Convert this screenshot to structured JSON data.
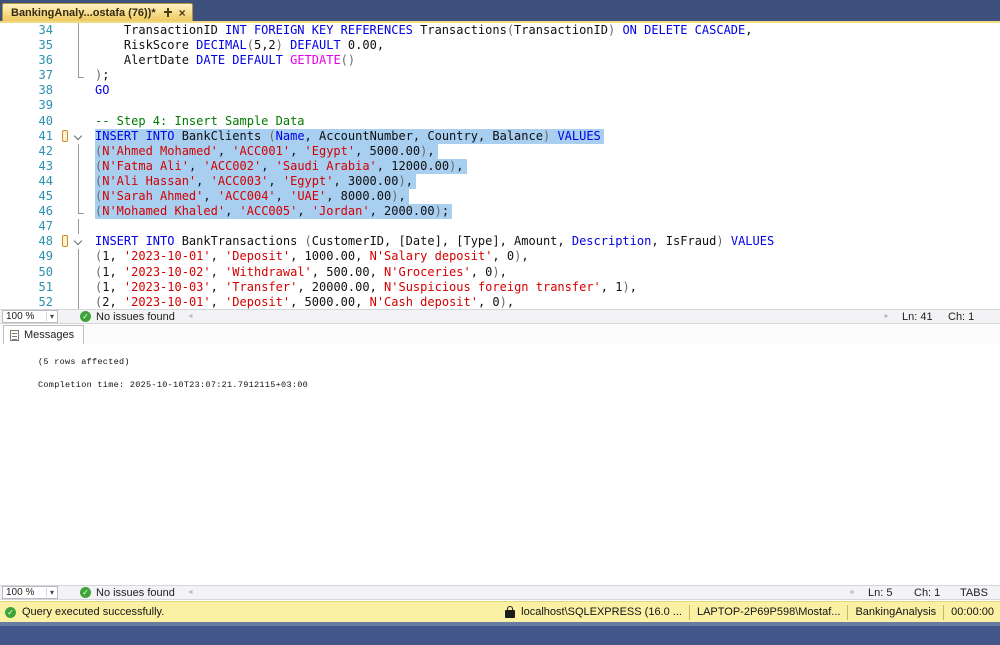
{
  "window": {
    "tab_title": "BankingAnaly...ostafa (76))*"
  },
  "icons": {
    "close": "×",
    "dropdown": "▾",
    "scroll_left": "◄",
    "scroll_right": "►",
    "check": "✓"
  },
  "colors": {
    "tab_active": "#EFC95F",
    "selection": "#A8CEF0",
    "keyword": "#0000E6",
    "string": "#D40000",
    "comment": "#007A00",
    "system_function": "#E800E8",
    "line_number": "#2B91AF",
    "success_bar": "#FAF1A5",
    "check_green": "#3EA437",
    "band_blue": "#3E517E"
  },
  "editor": {
    "lines": [
      {
        "n": 34,
        "fold": "line",
        "segs": [
          {
            "t": "    TransactionID ",
            "c": "id"
          },
          {
            "t": "INT FOREIGN KEY REFERENCES",
            "c": "kw"
          },
          {
            "t": " Transactions",
            "c": "id"
          },
          {
            "t": "(",
            "c": "op"
          },
          {
            "t": "TransactionID",
            "c": "id"
          },
          {
            "t": ")",
            "c": "op"
          },
          {
            "t": " ",
            "c": "id"
          },
          {
            "t": "ON DELETE CASCADE",
            "c": "kw"
          },
          {
            "t": ",",
            "c": "id"
          }
        ]
      },
      {
        "n": 35,
        "fold": "line",
        "segs": [
          {
            "t": "    RiskScore ",
            "c": "id"
          },
          {
            "t": "DECIMAL",
            "c": "kw"
          },
          {
            "t": "(",
            "c": "op"
          },
          {
            "t": "5,2",
            "c": "id"
          },
          {
            "t": ")",
            "c": "op"
          },
          {
            "t": " ",
            "c": "id"
          },
          {
            "t": "DEFAULT",
            "c": "kw"
          },
          {
            "t": " 0.00,",
            "c": "id"
          }
        ]
      },
      {
        "n": 36,
        "fold": "line",
        "segs": [
          {
            "t": "    AlertDate ",
            "c": "id"
          },
          {
            "t": "DATE DEFAULT",
            "c": "kw"
          },
          {
            "t": " ",
            "c": "id"
          },
          {
            "t": "GETDATE",
            "c": "fn"
          },
          {
            "t": "()",
            "c": "op"
          }
        ]
      },
      {
        "n": 37,
        "fold": "end",
        "segs": [
          {
            "t": ")",
            "c": "op"
          },
          {
            "t": ";",
            "c": "id"
          }
        ]
      },
      {
        "n": 38,
        "fold": "",
        "segs": [
          {
            "t": "GO",
            "c": "kw"
          }
        ]
      },
      {
        "n": 39,
        "fold": "",
        "segs": []
      },
      {
        "n": 40,
        "fold": "",
        "segs": [
          {
            "t": "-- Step 4: Insert Sample Data",
            "c": "com"
          }
        ]
      },
      {
        "n": 41,
        "fold": "open",
        "changed": true,
        "sel": true,
        "segs": [
          {
            "t": "INSERT INTO",
            "c": "kw"
          },
          {
            "t": " BankClients ",
            "c": "id"
          },
          {
            "t": "(",
            "c": "op"
          },
          {
            "t": "Name",
            "c": "kw"
          },
          {
            "t": ", AccountNumber, Country, Balance",
            "c": "id"
          },
          {
            "t": ")",
            "c": "op"
          },
          {
            "t": " ",
            "c": "id"
          },
          {
            "t": "VALUES",
            "c": "kw"
          }
        ]
      },
      {
        "n": 42,
        "fold": "line",
        "sel": true,
        "segs": [
          {
            "t": "(",
            "c": "op"
          },
          {
            "t": "N'Ahmed Mohamed'",
            "c": "str"
          },
          {
            "t": ", ",
            "c": "id"
          },
          {
            "t": "'ACC001'",
            "c": "str"
          },
          {
            "t": ", ",
            "c": "id"
          },
          {
            "t": "'Egypt'",
            "c": "str"
          },
          {
            "t": ", 5000.00",
            "c": "id"
          },
          {
            "t": ")",
            "c": "op"
          },
          {
            "t": ",",
            "c": "id"
          }
        ]
      },
      {
        "n": 43,
        "fold": "line",
        "sel": true,
        "segs": [
          {
            "t": "(",
            "c": "op"
          },
          {
            "t": "N'Fatma Ali'",
            "c": "str"
          },
          {
            "t": ", ",
            "c": "id"
          },
          {
            "t": "'ACC002'",
            "c": "str"
          },
          {
            "t": ", ",
            "c": "id"
          },
          {
            "t": "'Saudi Arabia'",
            "c": "str"
          },
          {
            "t": ", 12000.00",
            "c": "id"
          },
          {
            "t": ")",
            "c": "op"
          },
          {
            "t": ",",
            "c": "id"
          }
        ]
      },
      {
        "n": 44,
        "fold": "line",
        "sel": true,
        "segs": [
          {
            "t": "(",
            "c": "op"
          },
          {
            "t": "N'Ali Hassan'",
            "c": "str"
          },
          {
            "t": ", ",
            "c": "id"
          },
          {
            "t": "'ACC003'",
            "c": "str"
          },
          {
            "t": ", ",
            "c": "id"
          },
          {
            "t": "'Egypt'",
            "c": "str"
          },
          {
            "t": ", 3000.00",
            "c": "id"
          },
          {
            "t": ")",
            "c": "op"
          },
          {
            "t": ",",
            "c": "id"
          }
        ]
      },
      {
        "n": 45,
        "fold": "line",
        "sel": true,
        "segs": [
          {
            "t": "(",
            "c": "op"
          },
          {
            "t": "N'Sarah Ahmed'",
            "c": "str"
          },
          {
            "t": ", ",
            "c": "id"
          },
          {
            "t": "'ACC004'",
            "c": "str"
          },
          {
            "t": ", ",
            "c": "id"
          },
          {
            "t": "'UAE'",
            "c": "str"
          },
          {
            "t": ", 8000.00",
            "c": "id"
          },
          {
            "t": ")",
            "c": "op"
          },
          {
            "t": ",",
            "c": "id"
          }
        ]
      },
      {
        "n": 46,
        "fold": "end",
        "sel": true,
        "segs": [
          {
            "t": "(",
            "c": "op"
          },
          {
            "t": "N'Mohamed Khaled'",
            "c": "str"
          },
          {
            "t": ", ",
            "c": "id"
          },
          {
            "t": "'ACC005'",
            "c": "str"
          },
          {
            "t": ", ",
            "c": "id"
          },
          {
            "t": "'Jordan'",
            "c": "str"
          },
          {
            "t": ", 2000.00",
            "c": "id"
          },
          {
            "t": ")",
            "c": "op"
          },
          {
            "t": ";",
            "c": "id"
          }
        ]
      },
      {
        "n": 47,
        "fold": "line",
        "segs": []
      },
      {
        "n": 48,
        "fold": "open",
        "changed": true,
        "segs": [
          {
            "t": "INSERT INTO",
            "c": "kw"
          },
          {
            "t": " BankTransactions ",
            "c": "id"
          },
          {
            "t": "(",
            "c": "op"
          },
          {
            "t": "CustomerID, [Date], [Type], Amount, ",
            "c": "id"
          },
          {
            "t": "Description",
            "c": "kw"
          },
          {
            "t": ", IsFraud",
            "c": "id"
          },
          {
            "t": ")",
            "c": "op"
          },
          {
            "t": " ",
            "c": "id"
          },
          {
            "t": "VALUES",
            "c": "kw"
          }
        ]
      },
      {
        "n": 49,
        "fold": "line",
        "segs": [
          {
            "t": "(",
            "c": "op"
          },
          {
            "t": "1, ",
            "c": "id"
          },
          {
            "t": "'2023-10-01'",
            "c": "str"
          },
          {
            "t": ", ",
            "c": "id"
          },
          {
            "t": "'Deposit'",
            "c": "str"
          },
          {
            "t": ", 1000.00, ",
            "c": "id"
          },
          {
            "t": "N'Salary deposit'",
            "c": "str"
          },
          {
            "t": ", 0",
            "c": "id"
          },
          {
            "t": ")",
            "c": "op"
          },
          {
            "t": ",",
            "c": "id"
          }
        ]
      },
      {
        "n": 50,
        "fold": "line",
        "segs": [
          {
            "t": "(",
            "c": "op"
          },
          {
            "t": "1, ",
            "c": "id"
          },
          {
            "t": "'2023-10-02'",
            "c": "str"
          },
          {
            "t": ", ",
            "c": "id"
          },
          {
            "t": "'Withdrawal'",
            "c": "str"
          },
          {
            "t": ", 500.00, ",
            "c": "id"
          },
          {
            "t": "N'Groceries'",
            "c": "str"
          },
          {
            "t": ", 0",
            "c": "id"
          },
          {
            "t": ")",
            "c": "op"
          },
          {
            "t": ",",
            "c": "id"
          }
        ]
      },
      {
        "n": 51,
        "fold": "line",
        "segs": [
          {
            "t": "(",
            "c": "op"
          },
          {
            "t": "1, ",
            "c": "id"
          },
          {
            "t": "'2023-10-03'",
            "c": "str"
          },
          {
            "t": ", ",
            "c": "id"
          },
          {
            "t": "'Transfer'",
            "c": "str"
          },
          {
            "t": ", 20000.00, ",
            "c": "id"
          },
          {
            "t": "N'Suspicious foreign transfer'",
            "c": "str"
          },
          {
            "t": ", 1",
            "c": "id"
          },
          {
            "t": ")",
            "c": "op"
          },
          {
            "t": ",",
            "c": "id"
          }
        ]
      },
      {
        "n": 52,
        "fold": "line",
        "segs": [
          {
            "t": "(",
            "c": "op"
          },
          {
            "t": "2, ",
            "c": "id"
          },
          {
            "t": "'2023-10-01'",
            "c": "str"
          },
          {
            "t": ", ",
            "c": "id"
          },
          {
            "t": "'Deposit'",
            "c": "str"
          },
          {
            "t": ", 5000.00, ",
            "c": "id"
          },
          {
            "t": "N'Cash deposit'",
            "c": "str"
          },
          {
            "t": ", 0",
            "c": "id"
          },
          {
            "t": ")",
            "c": "op"
          },
          {
            "t": ",",
            "c": "id"
          }
        ]
      }
    ]
  },
  "editor_statusbar": {
    "zoom": "100 %",
    "health": "No issues found",
    "ln": "Ln: 41",
    "ch": "Ch: 1"
  },
  "messages": {
    "tab_label": "Messages",
    "lines": [
      "(5 rows affected)",
      "Completion time: 2025-10-10T23:07:21.7912115+03:00"
    ]
  },
  "messages_statusbar": {
    "zoom": "100 %",
    "health": "No issues found",
    "ln": "Ln: 5",
    "ch": "Ch: 1",
    "tabs": "TABS"
  },
  "footer": {
    "status": "Query executed successfully.",
    "server": "localhost\\SQLEXPRESS (16.0 ...",
    "user": "LAPTOP-2P69P598\\Mostaf...",
    "database": "BankingAnalysis",
    "time": "00:00:00"
  }
}
